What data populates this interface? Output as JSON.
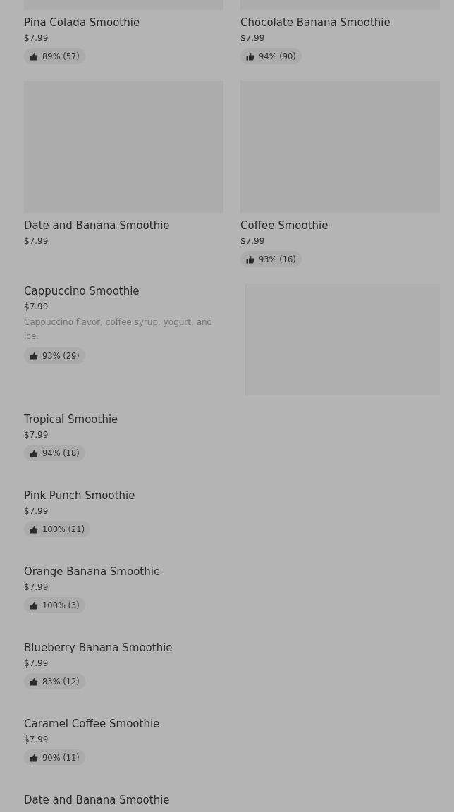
{
  "grid": [
    {
      "name": "Pina Colada Smoothie",
      "price": "$7.99",
      "rating": "89% (57)"
    },
    {
      "name": "Chocolate Banana Smoothie",
      "price": "$7.99",
      "rating": "94% (90)"
    },
    {
      "name": "Date and Banana Smoothie",
      "price": "$7.99"
    },
    {
      "name": "Coffee Smoothie",
      "price": "$7.99",
      "rating": "93% (16)"
    }
  ],
  "list": [
    {
      "name": "Cappuccino Smoothie",
      "price": "$7.99",
      "description": "Cappuccino flavor, coffee syrup, yogurt, and ice.",
      "rating": "93% (29)",
      "kind": "picture"
    },
    {
      "name": "Tropical Smoothie",
      "price": "$7.99",
      "rating": "94% (18)",
      "kind": "plain"
    },
    {
      "name": "Pink Punch Smoothie",
      "price": "$7.99",
      "rating": "100% (21)",
      "kind": "plain"
    },
    {
      "name": "Orange Banana Smoothie",
      "price": "$7.99",
      "rating": "100% (3)",
      "kind": "plain"
    },
    {
      "name": "Blueberry Banana Smoothie",
      "price": "$7.99",
      "rating": "83% (12)",
      "kind": "plain"
    },
    {
      "name": "Caramel Coffee Smoothie",
      "price": "$7.99",
      "rating": "90% (11)",
      "kind": "plain"
    },
    {
      "name": "Date and Banana Smoothie",
      "kind": "plain"
    }
  ]
}
